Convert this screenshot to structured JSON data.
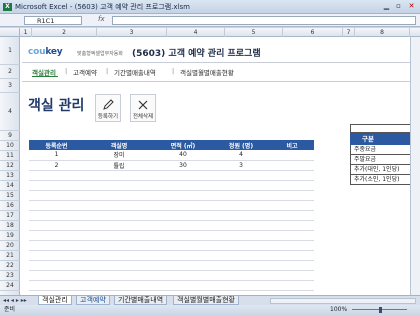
{
  "window": {
    "title": "Microsoft Excel - (5603) 고객 예약 관리 프로그램.xlsm",
    "minimize_glyph": "▁",
    "restore_glyph": "▫",
    "close_glyph": "✕"
  },
  "formula_bar": {
    "name_box": "R1C1",
    "fx_label": "fx",
    "formula": ""
  },
  "columns": [
    "1",
    "2",
    "3",
    "4",
    "5",
    "6",
    "7",
    "8"
  ],
  "rows": [
    "1",
    "2",
    "3",
    "4",
    "5",
    "6",
    "7",
    "8",
    "9",
    "10",
    "11",
    "12",
    "13",
    "14",
    "15",
    "16",
    "17",
    "18",
    "19",
    "20",
    "21",
    "22",
    "23",
    "24",
    "25",
    "26",
    "27",
    "28"
  ],
  "header": {
    "logo": "cou",
    "logo_accent": "key",
    "tagline": "맞춤형엑셀업무자동화",
    "app_title": "(5603) 고객 예약 관리 프로그램"
  },
  "menu": {
    "items": [
      "객실관리",
      "고객예약",
      "기간별매출내역",
      "객실별월별매출현황"
    ],
    "separator": "|"
  },
  "page": {
    "heading": "객실 관리",
    "register_button": "등록하기",
    "delete_all_button": "전체삭제"
  },
  "table": {
    "columns": [
      "등록순번",
      "객실명",
      "면적 (㎡)",
      "정원 (명)",
      "비고"
    ],
    "rows": [
      [
        "1",
        "장미",
        "40",
        "4",
        ""
      ],
      [
        "2",
        "튤립",
        "30",
        "3",
        ""
      ]
    ]
  },
  "side_table": {
    "header": "구분",
    "items": [
      "주중요금",
      "주말요금",
      "추가(대인, 1인당)",
      "추가(소인, 1인당)"
    ]
  },
  "sheet_tabs": {
    "nav": "◂◂ ◂ ▸ ▸▸",
    "tabs": [
      "객실관리",
      "고객예약",
      "기간별매출내역",
      "객실별월별매출현황"
    ],
    "active": "객실관리"
  },
  "status": {
    "text": "준비",
    "zoom": "100%"
  },
  "colors": {
    "accent": "#2c5aa2",
    "menu_active": "#2a7e3c",
    "heading": "#213a6a"
  }
}
